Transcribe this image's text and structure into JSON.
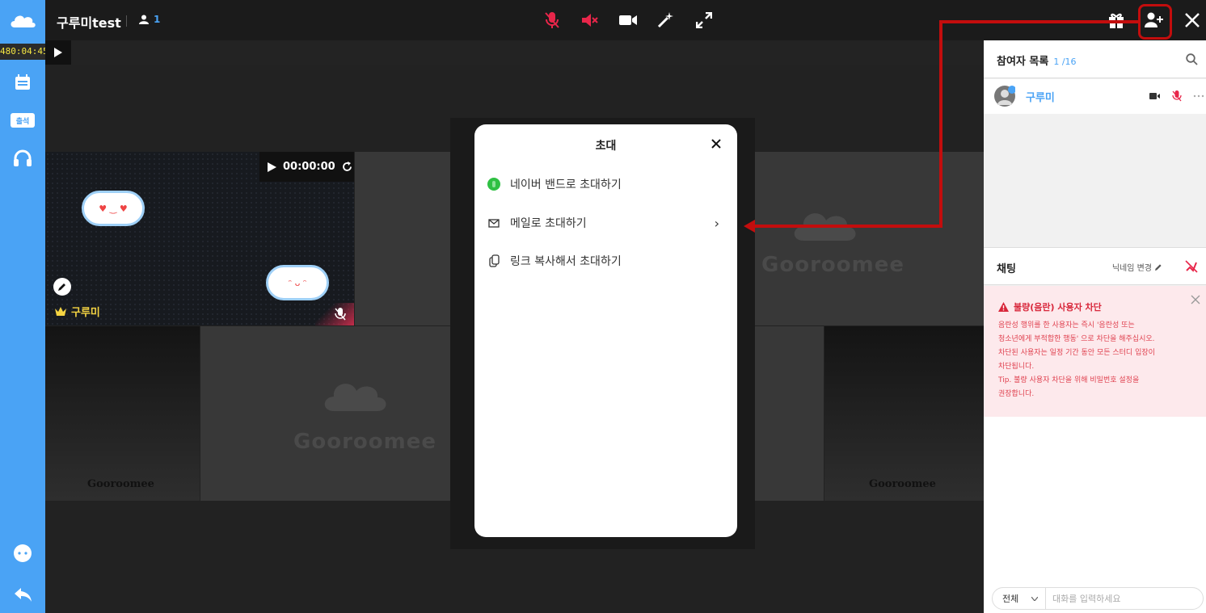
{
  "app": {
    "title": "구루미test",
    "participant_count": "1",
    "timer": "480:04:45",
    "brand": "Gooroomee",
    "brand_small": "Gooroomee"
  },
  "sidebar": {
    "items": [
      {
        "icon": "calendar-icon"
      },
      {
        "label": "출석"
      },
      {
        "icon": "headset-icon"
      },
      {
        "icon": "chat-bubble-icon"
      },
      {
        "icon": "exit-icon"
      }
    ]
  },
  "video": {
    "time": "00:00:00",
    "owner_name": "구루미"
  },
  "modal": {
    "title": "초대",
    "items": [
      {
        "label": "네이버 밴드로 초대하기",
        "icon": "band-icon"
      },
      {
        "label": "메일로 초대하기",
        "icon": "mail-icon"
      },
      {
        "label": "링크 복사해서 초대하기",
        "icon": "clip-icon"
      }
    ]
  },
  "participants": {
    "title": "참여자 목록",
    "count": "1 /16",
    "users": [
      {
        "name": "구루미"
      }
    ]
  },
  "chat": {
    "title": "채팅",
    "nickname_change": "닉네임 변경",
    "warning_title": "불량(음란) 사용자 차단",
    "warning_lines": [
      "음란성 행위를 한 사용자는 즉시 '음란성 또는",
      "청소년에게 부적합한 행동' 으로 차단을 해주십시오.",
      "차단된 사용자는 일정 기간 동안 모든 스터디 입장이",
      "차단됩니다.",
      "Tip. 불량 사용자 차단을 위해 비밀번호 설정을",
      "권장합니다."
    ],
    "scope_select": "전체",
    "input_placeholder": "대화를 입력하세요"
  },
  "colors": {
    "accent": "#4aa3f5",
    "danger": "#e8264a",
    "highlight": "#c30d0d"
  }
}
